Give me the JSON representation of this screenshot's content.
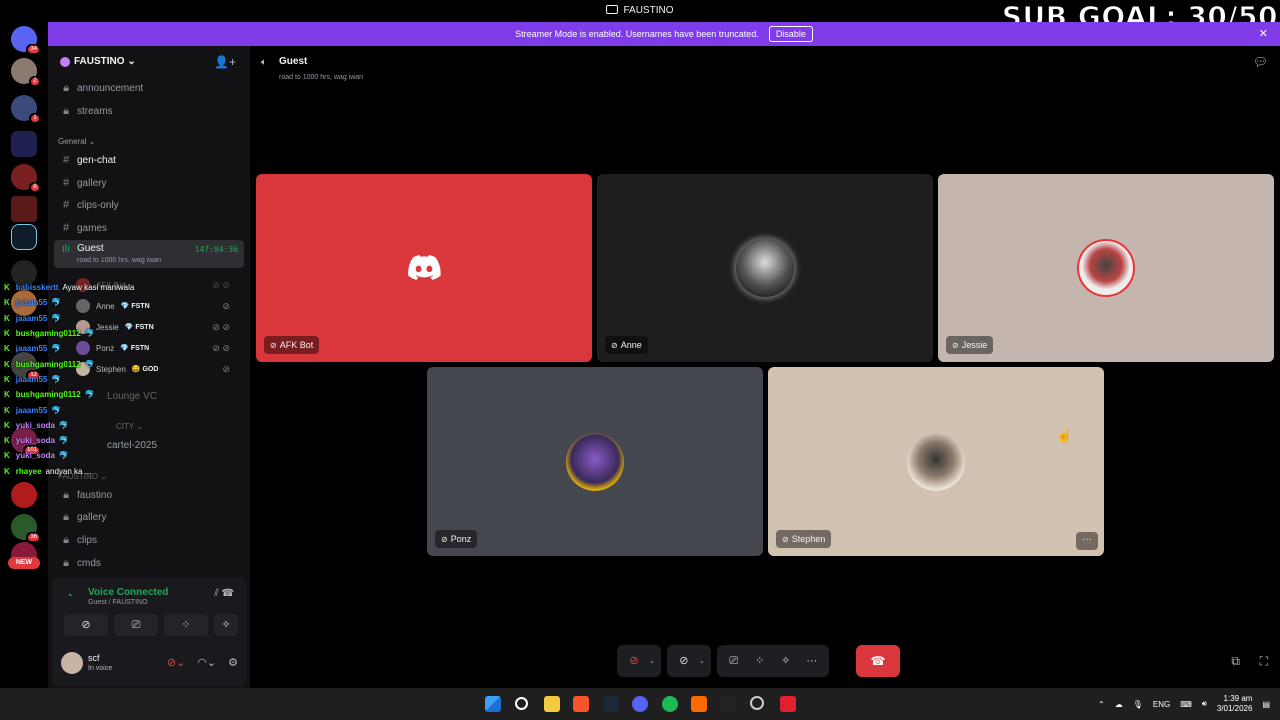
{
  "window": {
    "title": "FAUSTINO",
    "overlay_text": "SUB GOAL: 30/50"
  },
  "banner": {
    "message": "Streamer Mode is enabled. Usernames have been truncated.",
    "disable_label": "Disable",
    "close_icon": "close-icon"
  },
  "rail": {
    "badges": [
      "34",
      "2",
      "1",
      "8",
      "101",
      "12",
      "36"
    ],
    "new_label": "NEW"
  },
  "sidebar": {
    "server_name": "FAUSTINO",
    "channels_top": [
      {
        "name": "announcement",
        "icon": "lock-icon"
      },
      {
        "name": "streams",
        "icon": "lock-icon"
      }
    ],
    "category_general": "General",
    "channels_general": [
      {
        "name": "gen-chat",
        "icon": "hash-icon"
      },
      {
        "name": "gallery",
        "icon": "hash-icon"
      },
      {
        "name": "clips-only",
        "icon": "hash-icon"
      },
      {
        "name": "games",
        "icon": "hash-icon"
      }
    ],
    "voice_channel": {
      "name": "Guest",
      "timer": "147:04:36",
      "topic": "road to 1000 hrs, wag iwan"
    },
    "voice_users": [
      {
        "name": "AFK Bot",
        "tag": ""
      },
      {
        "name": "Anne",
        "tag": "💎 FSTN"
      },
      {
        "name": "Jessie",
        "tag": "💎 FSTN"
      },
      {
        "name": "Ponz",
        "tag": "💎 FSTN"
      },
      {
        "name": "Stephen",
        "tag": "😀 GOD"
      }
    ],
    "partial_items": [
      "Lounge VC",
      "CITY",
      "cartel-2025",
      "FAUSTINO"
    ],
    "channels_bottom": [
      {
        "name": "faustino",
        "icon": "lock-icon"
      },
      {
        "name": "gallery",
        "icon": "lock-icon"
      },
      {
        "name": "clips",
        "icon": "lock-icon"
      },
      {
        "name": "cmds",
        "icon": "lock-icon"
      }
    ]
  },
  "chat_overlay": [
    {
      "user": "babisskertt",
      "color": "#3b82f6",
      "msg": "Ayaw kasi maniwala"
    },
    {
      "user": "jaaam55",
      "color": "#3b82f6",
      "msg": "🐬"
    },
    {
      "user": "jaaam55",
      "color": "#3b82f6",
      "msg": "🐬"
    },
    {
      "user": "bushgaming0112",
      "color": "#53fc18",
      "msg": "🐬"
    },
    {
      "user": "jaaam55",
      "color": "#3b82f6",
      "msg": "🐬"
    },
    {
      "user": "bushgaming0112",
      "color": "#53fc18",
      "msg": "🐬"
    },
    {
      "user": "jaaam55",
      "color": "#3b82f6",
      "msg": "🐬"
    },
    {
      "user": "bushgaming0112",
      "color": "#53fc18",
      "msg": "🐬"
    },
    {
      "user": "jaaam55",
      "color": "#3b82f6",
      "msg": "🐬"
    },
    {
      "user": "yuki_soda",
      "color": "#c084fc",
      "msg": "🐬"
    },
    {
      "user": "yuki_soda",
      "color": "#c084fc",
      "msg": "🐬"
    },
    {
      "user": "yuki_soda",
      "color": "#c084fc",
      "msg": "🐬"
    },
    {
      "user": "rhayee",
      "color": "#53fc18",
      "msg": "andyan ka ..."
    }
  ],
  "voice_panel": {
    "status": "Voice Connected",
    "location": "Guest / FAUSTINO",
    "user_name": "scf",
    "user_status": "In voice"
  },
  "stage": {
    "channel_name": "Guest",
    "topic": "road to 1000 hrs, wag iwan",
    "tiles": [
      {
        "name": "AFK Bot",
        "bg": "#da373c"
      },
      {
        "name": "Anne",
        "bg": "#1e1e20"
      },
      {
        "name": "Jessie",
        "bg": "#c4b6ae"
      },
      {
        "name": "Ponz",
        "bg": "#45474e"
      },
      {
        "name": "Stephen",
        "bg": "#d1c2b1"
      }
    ]
  },
  "taskbar": {
    "lang": "ENG",
    "time": "1:39 am",
    "date": "3/01/2026"
  },
  "colors": {
    "accent": "#5865f2",
    "banner": "#7f3ce8",
    "hangup": "#da373c",
    "voice_green": "#23a55a"
  }
}
